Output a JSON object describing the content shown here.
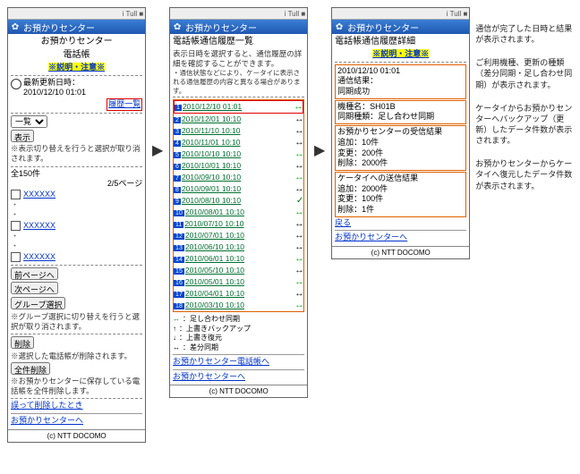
{
  "statusbar_text": "i Tull ■",
  "titlebar": "お預かりセンター",
  "warn_link": "※説明・注意※",
  "footer": "(c) NTT DOCOMO",
  "screen1": {
    "heading1": "お預かりセンター",
    "heading2": "電話帳",
    "updated_label": "最新更新日時：",
    "updated_value": "2010/12/10 01:01",
    "history_link": "履歴一覧",
    "select_label": "一覧",
    "show_btn": "表示",
    "switch_note": "※表示切り替えを行うと選択が取り消されます。",
    "count": "全150件",
    "page": "2/5ページ",
    "entries": [
      "XXXXXX",
      "XXXXXX",
      "XXXXXX"
    ],
    "prev_btn": "前ページへ",
    "next_btn": "次ページへ",
    "group_btn": "グループ選択",
    "group_note": "※グループ選択に切り替えを行うと選択が取り消されます。",
    "delete_btn": "削除",
    "delete_note": "※選択した電話帳が削除されます。",
    "delete_all_btn": "全件削除",
    "delete_all_note": "※お預かりセンターに保存している電話帳を全件削除します。",
    "mistake_link": "誤って削除したとき",
    "back_link": "お預かりセンターへ"
  },
  "screen2": {
    "heading": "電話帳通信履歴一覧",
    "instr": "表示日時を選択すると、通信履歴の詳細を確認することができます。",
    "instr2": "・通信状態などにより、ケータイに表示される通信履歴の内容と異なる場合があります。",
    "items": [
      {
        "n": "1",
        "t": "2010/12/10 01:01",
        "cls": "green"
      },
      {
        "n": "2",
        "t": "2010/12/01 10:10",
        "cls": "black"
      },
      {
        "n": "3",
        "t": "2010/11/10 10:10",
        "cls": "black"
      },
      {
        "n": "4",
        "t": "2010/11/01 10:10",
        "cls": "black"
      },
      {
        "n": "5",
        "t": "2010/10/10 10:10",
        "cls": "green"
      },
      {
        "n": "6",
        "t": "2010/10/01 10:10",
        "cls": "black"
      },
      {
        "n": "7",
        "t": "2010/09/10 10:10",
        "cls": "green"
      },
      {
        "n": "8",
        "t": "2010/09/01 10:10",
        "cls": "black"
      },
      {
        "n": "9",
        "t": "2010/08/10 10:10",
        "cls": "check"
      },
      {
        "n": "10",
        "t": "2010/08/01 10:10",
        "cls": "green"
      },
      {
        "n": "11",
        "t": "2010/07/10 10:10",
        "cls": "black"
      },
      {
        "n": "12",
        "t": "2010/07/01 10:10",
        "cls": "black"
      },
      {
        "n": "13",
        "t": "2010/06/10 10:10",
        "cls": "black"
      },
      {
        "n": "14",
        "t": "2010/06/01 10:10",
        "cls": "green"
      },
      {
        "n": "15",
        "t": "2010/05/10 10:10",
        "cls": "black"
      },
      {
        "n": "16",
        "t": "2010/05/01 10:10",
        "cls": "green"
      },
      {
        "n": "17",
        "t": "2010/04/01 10:10",
        "cls": "black"
      },
      {
        "n": "18",
        "t": "2010/03/10 10:10",
        "cls": "green"
      }
    ],
    "legend": [
      {
        "ico": "↔",
        "txt": "足し合わせ同期",
        "color": "#0a0"
      },
      {
        "ico": "↑",
        "txt": "上書きバックアップ",
        "color": "#000"
      },
      {
        "ico": "↓",
        "txt": "上書き復元",
        "color": "#000"
      },
      {
        "ico": "↔",
        "txt": "差分同期",
        "color": "#000"
      }
    ],
    "link1": "お預かりセンター電話帳へ",
    "link2": "お預かりセンターへ"
  },
  "screen3": {
    "heading": "電話帳通信履歴詳細",
    "block1_l1": "2010/12/10 01:01",
    "block1_l2": "通信結果：",
    "block1_l3": "同期成功",
    "block2_l1": "機種名：SH01B",
    "block2_l2": "同期種類：足し合わせ同期",
    "block3_title": "お預かりセンターの受信結果",
    "block3_l1": "追加：10件",
    "block3_l2": "変更：200件",
    "block3_l3": "削除：2000件",
    "block4_title": "ケータイへの送信結果",
    "block4_l1": "追加：2000件",
    "block4_l2": "変更：100件",
    "block4_l3": "削除：1件",
    "back": "戻る",
    "back2": "お預かりセンターへ"
  },
  "annotations": {
    "a1": "通信が完了した日時と結果が表示されます。",
    "a2": "ご利用機種、更新の種類（差分同期・足し合わせ同期）が表示されます。",
    "a3": "ケータイからお預かりセンターへバックアップ（更新）したデータ件数が表示されます。",
    "a4": "お預かりセンターからケータイへ復元したデータ件数が表示されます。"
  }
}
